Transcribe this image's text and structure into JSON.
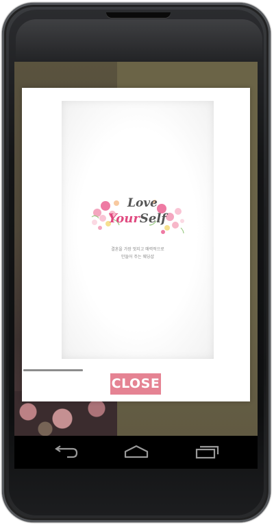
{
  "dialog": {
    "logo": {
      "line1": "Love",
      "line2_part1": "Your",
      "line2_part2": "Self"
    },
    "tagline_line1": "결혼을 가장 멋지고 매력적으로",
    "tagline_line2": "만들어 주는 웨딩샵",
    "progress": 0.26,
    "close_label": "CLOSE"
  },
  "navbar": {
    "buttons": [
      "back-icon",
      "home-icon",
      "recent-apps-icon"
    ]
  },
  "colors": {
    "accent": "#e58393",
    "logo_pink": "#e0497f",
    "logo_gray": "#555555",
    "navbar": "#000000"
  }
}
